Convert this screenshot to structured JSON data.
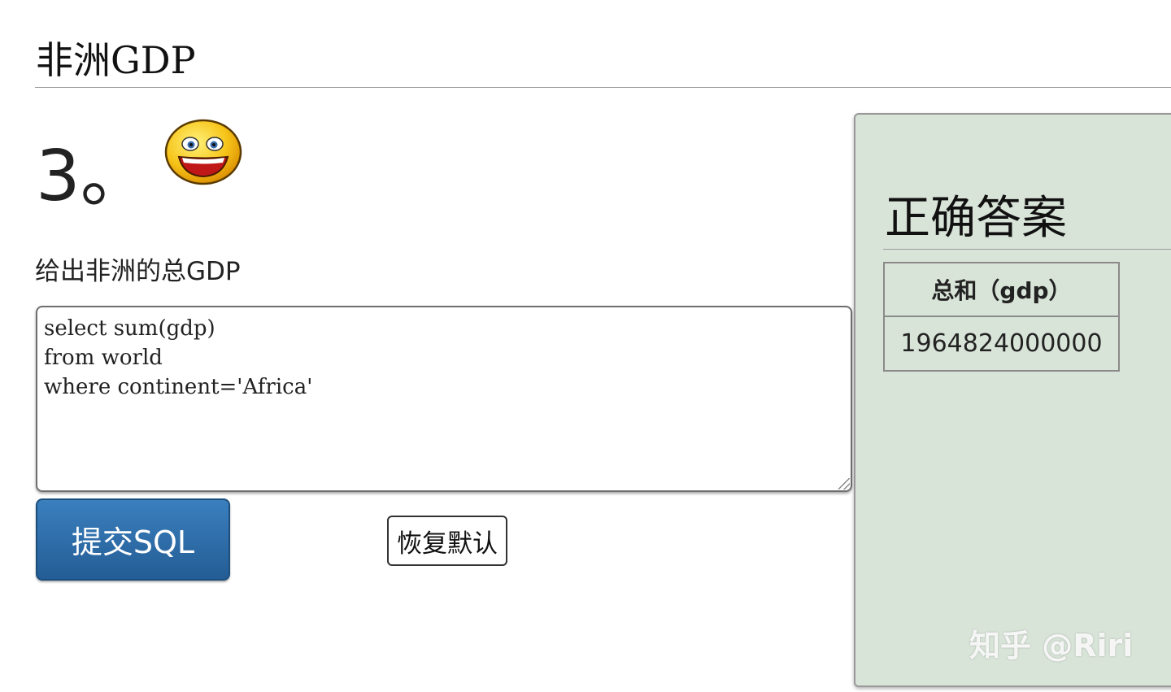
{
  "page": {
    "title": "非洲GDP",
    "question_number": "3。",
    "question_text": "给出非洲的总GDP"
  },
  "editor": {
    "sql": "select sum(gdp)\nfrom world\nwhere continent='Africa'"
  },
  "buttons": {
    "submit_label": "提交SQL",
    "reset_label": "恢复默认"
  },
  "answer": {
    "title": "正确答案",
    "columns": [
      "总和（gdp）"
    ],
    "rows": [
      [
        "1964824000000"
      ]
    ]
  },
  "watermark": "知乎 @Riri",
  "icons": {
    "smiley": "smiley-face-icon"
  },
  "colors": {
    "submit_button": "#2f6ea9",
    "answer_panel_bg": "#d9e4d9"
  }
}
